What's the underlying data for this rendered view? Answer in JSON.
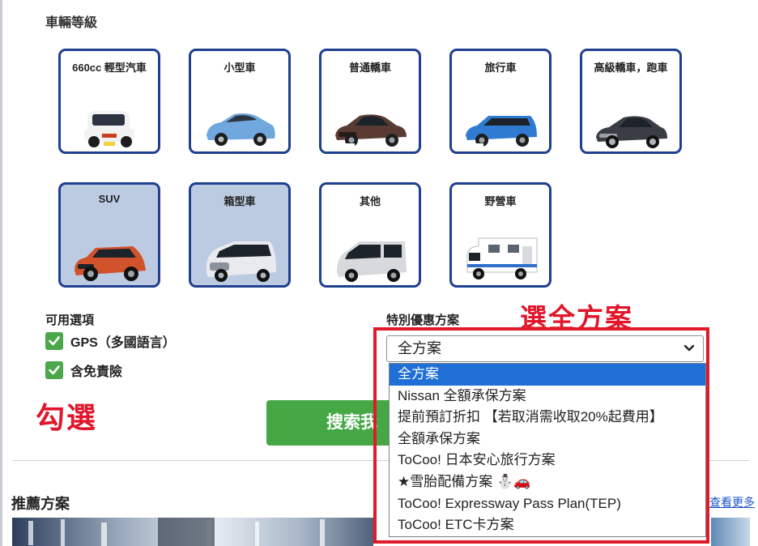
{
  "vehicle_class": {
    "title": "車輛等級",
    "cards": [
      {
        "label": "660cc 輕型汽車",
        "selected": false,
        "color": "#f2f2f2",
        "accent": "#c9401e"
      },
      {
        "label": "小型車",
        "selected": false,
        "color": "#6fa7de",
        "accent": "#2b5f9d"
      },
      {
        "label": "普通轎車",
        "selected": false,
        "color": "#5a3b33",
        "accent": "#2a1b16"
      },
      {
        "label": "旅行車",
        "selected": false,
        "color": "#2f7bd1",
        "accent": "#1c4f8f"
      },
      {
        "label": "高級轎車，跑車",
        "selected": false,
        "color": "#3a3d44",
        "accent": "#15171b"
      },
      {
        "label": "SUV",
        "selected": true,
        "color": "#d2522b",
        "accent": "#8c2e15"
      },
      {
        "label": "箱型車",
        "selected": true,
        "color": "#e9eaee",
        "accent": "#7f8794"
      },
      {
        "label": "其他",
        "selected": false,
        "color": "#d7d9dd",
        "accent": "#6e737c"
      },
      {
        "label": "野營車",
        "selected": false,
        "color": "#ffffff",
        "accent": "#8f949c"
      }
    ]
  },
  "options": {
    "title": "可用選項",
    "items": [
      {
        "label": "GPS（多國語言）",
        "checked": true
      },
      {
        "label": "含免責險",
        "checked": true
      }
    ]
  },
  "special_plan": {
    "title": "特別優惠方案",
    "selected_value": "全方案",
    "dropdown_items": [
      "全方案",
      "Nissan 全額承保方案",
      "提前預訂折扣 【若取消需收取20%起費用】",
      "全額承保方案",
      "ToCoo! 日本安心旅行方案",
      "★雪胎配備方案 ⛄🚗",
      "ToCoo! Expressway Pass Plan(TEP)",
      "ToCoo! ETC卡方案"
    ],
    "highlighted_index": 0
  },
  "annotations": {
    "select_all_plans": "選全方案",
    "tick": "勾選"
  },
  "search_button": {
    "label": "搜索我"
  },
  "recommended": {
    "title": "推薦方案",
    "more_link": "查看更多"
  },
  "colors": {
    "card_border": "#1f3f8f",
    "card_selected_bg": "#bccbe2",
    "check_green": "#4aa84a",
    "search_green": "#45a844",
    "annotation_red": "#e1162a",
    "dropdown_highlight": "#1f6fd6"
  }
}
